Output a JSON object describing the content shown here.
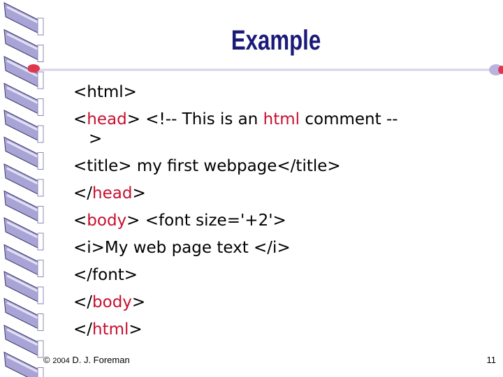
{
  "slide": {
    "title": "Example",
    "lines": [
      {
        "id": "l1",
        "segments": [
          {
            "text": "<html>",
            "hl": false
          }
        ]
      },
      {
        "id": "l2",
        "segments": [
          {
            "text": "<",
            "hl": false
          },
          {
            "text": "head",
            "hl": true
          },
          {
            "text": "> <!-- This is an ",
            "hl": false
          },
          {
            "text": "html",
            "hl": true
          },
          {
            "text": " comment  --",
            "hl": false
          }
        ]
      },
      {
        "id": "l2b",
        "cont": true,
        "segments": [
          {
            "text": ">",
            "hl": false
          }
        ]
      },
      {
        "id": "l3",
        "segments": [
          {
            "text": "<title> my first webpage</title>",
            "hl": false
          }
        ]
      },
      {
        "id": "l4",
        "segments": [
          {
            "text": "</",
            "hl": false
          },
          {
            "text": "head",
            "hl": true
          },
          {
            "text": ">",
            "hl": false
          }
        ]
      },
      {
        "id": "l5",
        "segments": [
          {
            "text": "<",
            "hl": false
          },
          {
            "text": "body",
            "hl": true
          },
          {
            "text": "> <font size='+2'>",
            "hl": false
          }
        ]
      },
      {
        "id": "l6",
        "segments": [
          {
            "text": "<i>My web page text </i>",
            "hl": false
          }
        ]
      },
      {
        "id": "l7",
        "segments": [
          {
            "text": "</font>",
            "hl": false
          }
        ]
      },
      {
        "id": "l8",
        "segments": [
          {
            "text": "</",
            "hl": false
          },
          {
            "text": "body",
            "hl": true
          },
          {
            "text": ">",
            "hl": false
          }
        ]
      },
      {
        "id": "l9",
        "segments": [
          {
            "text": "</",
            "hl": false
          },
          {
            "text": "html",
            "hl": true
          },
          {
            "text": ">",
            "hl": false
          }
        ]
      }
    ]
  },
  "footer": {
    "copyright_symbol": "©",
    "year": "2004",
    "author": "D. J. Foreman",
    "page_number": "11"
  },
  "colors": {
    "title": "#1a1a7a",
    "highlight": "#c8102e",
    "spiral_fill": "#a9a4d6",
    "spiral_edge": "#3c3a6e",
    "rule_red": "#e0374f"
  }
}
